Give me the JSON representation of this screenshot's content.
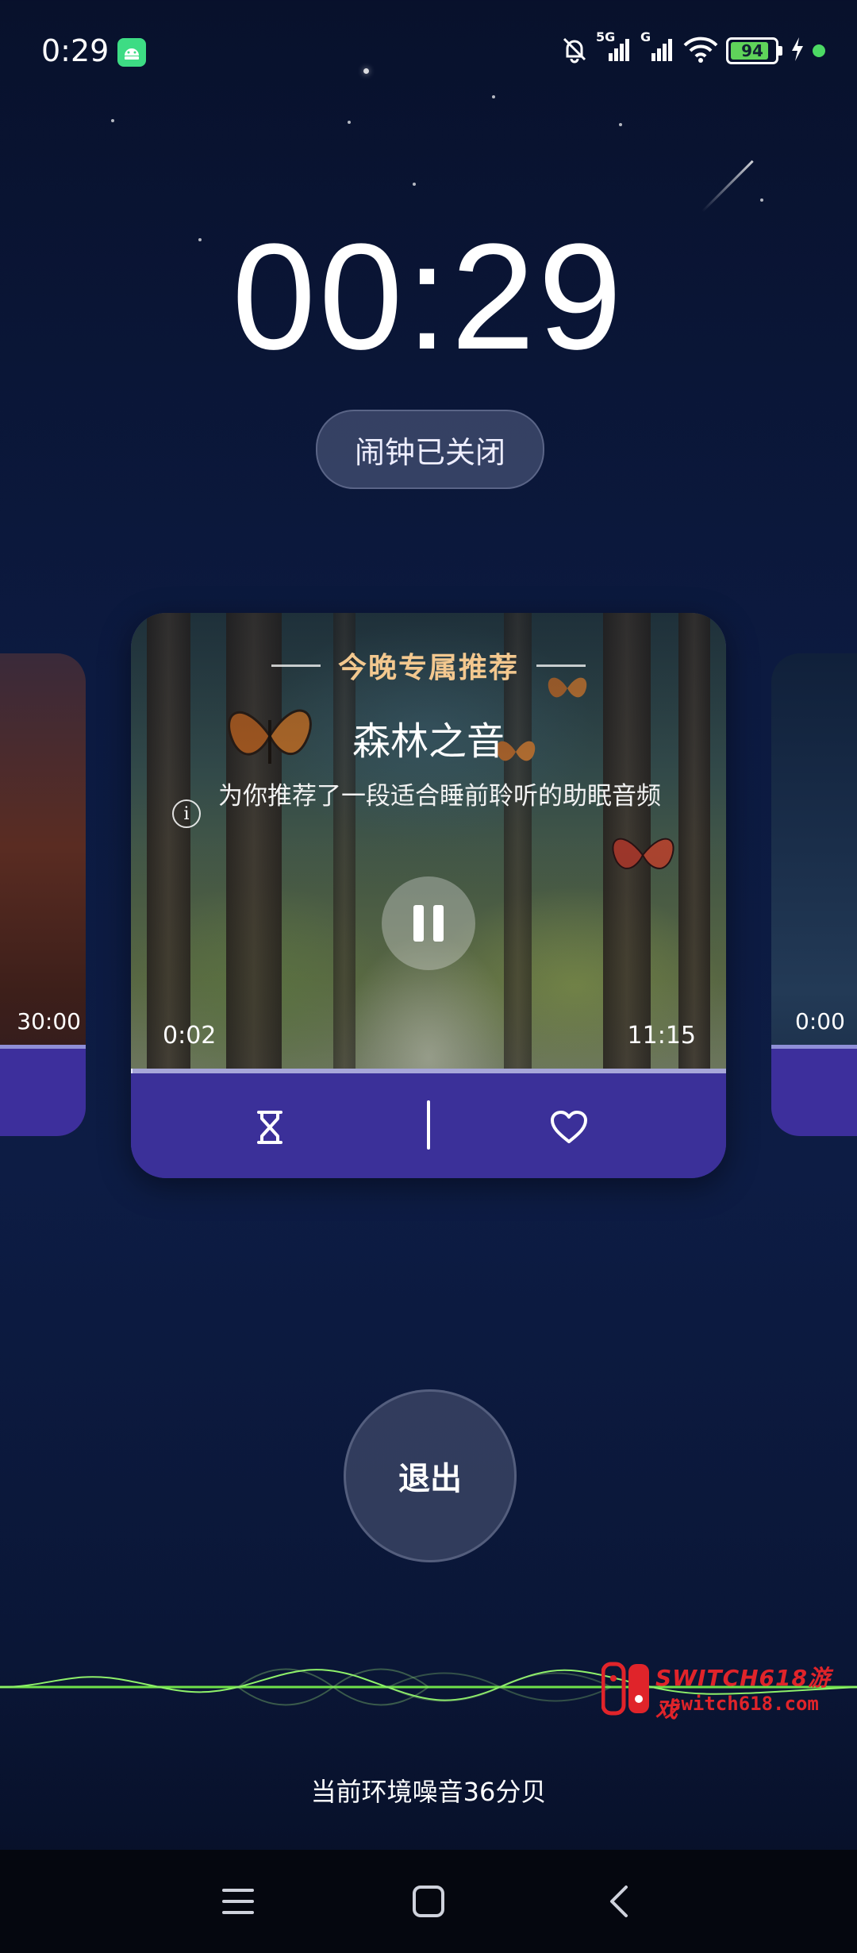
{
  "status_bar": {
    "time": "0:29",
    "signal_1": "5G",
    "signal_2": "G",
    "battery": "94"
  },
  "clock": {
    "time": "00:29",
    "alarm_status": "闹钟已关闭"
  },
  "cards": {
    "left": {
      "duration": "30:00"
    },
    "right": {
      "elapsed": "0:00"
    },
    "main": {
      "section_label": "今晚专属推荐",
      "title": "森林之音",
      "description": "为你推荐了一段适合睡前聆听的助眠音频",
      "elapsed": "0:02",
      "duration": "11:15",
      "progress_fraction": 0.003,
      "state": "playing"
    }
  },
  "actions": {
    "exit_label": "退出"
  },
  "watermark": {
    "line1": "SWITCH618游戏",
    "line2": "switch618.com"
  },
  "ambient": {
    "noise_text": "当前环境噪音36分贝"
  },
  "colors": {
    "accent_purple": "#3b3099",
    "recommend_gold": "#f3c88f",
    "wave_green": "#6fe04a"
  },
  "icons": {
    "pause": "pause-icon",
    "timer": "hourglass-icon",
    "favorite": "heart-icon",
    "info": "info-icon"
  }
}
